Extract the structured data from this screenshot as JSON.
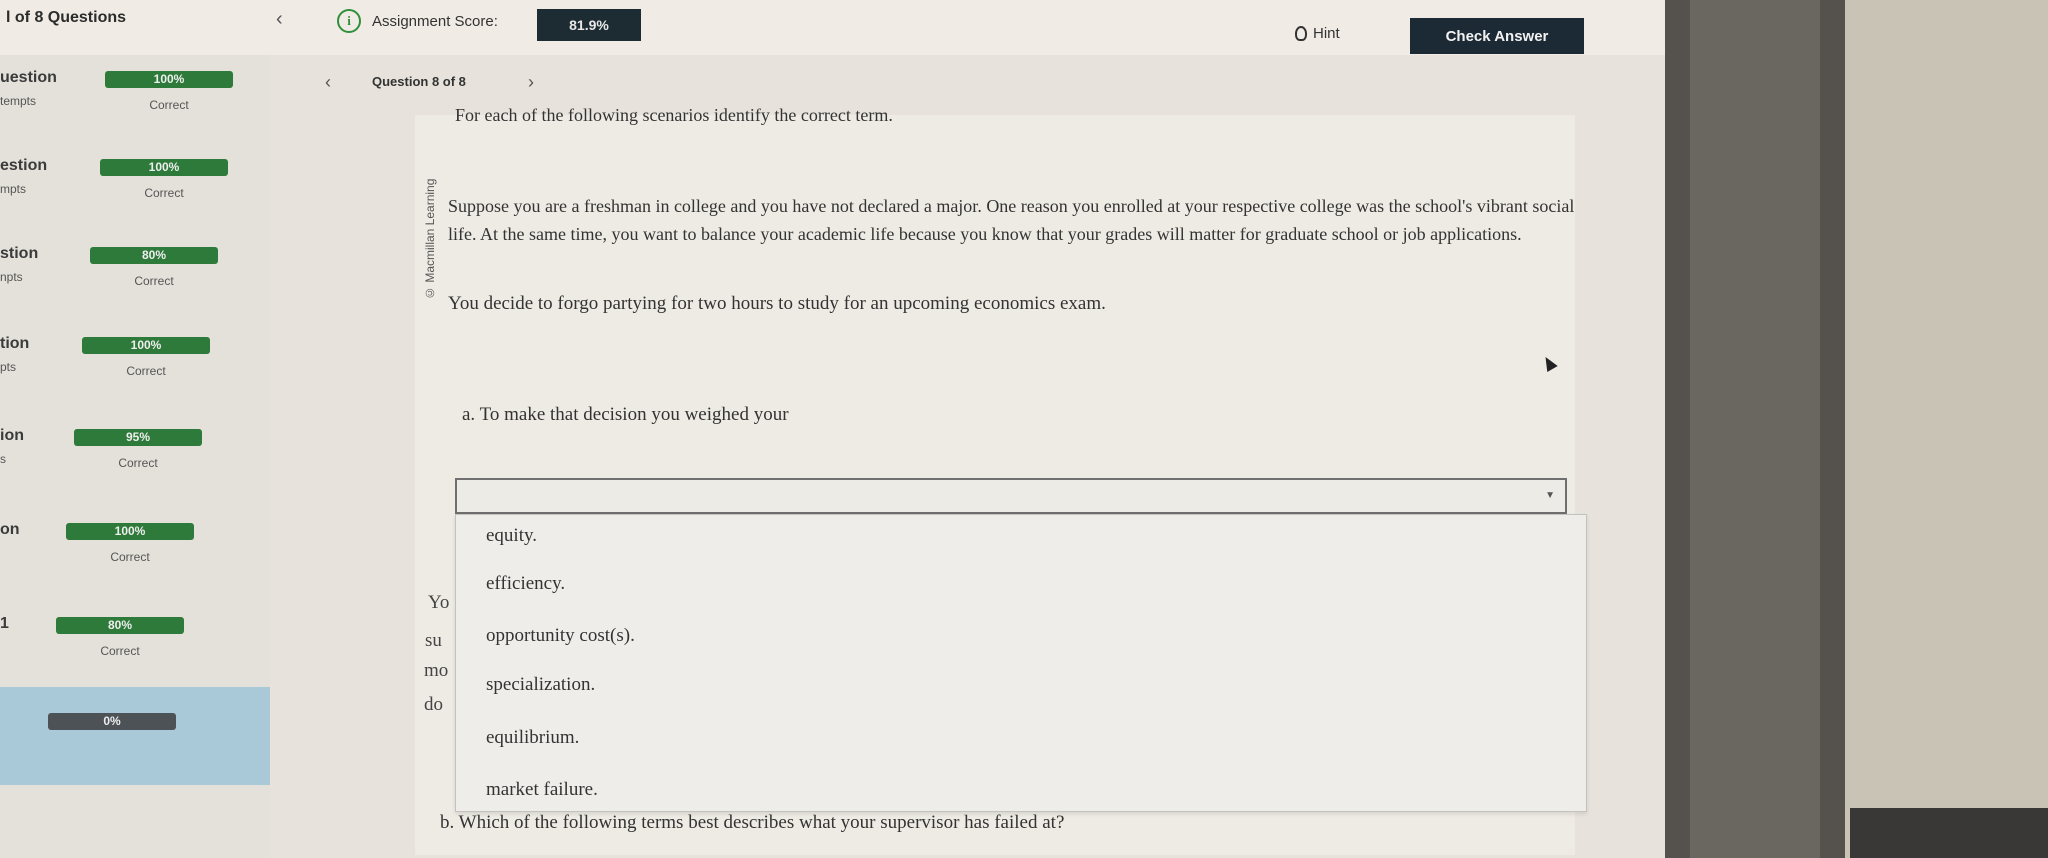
{
  "header": {
    "question_count": "l of 8 Questions",
    "score_label": "Assignment Score:",
    "score_value": "81.9%",
    "hint_label": "Hint",
    "check_answer_label": "Check Answer"
  },
  "sidebar": {
    "items": [
      {
        "label": "uestion",
        "attempts": "tempts",
        "percent": "100%",
        "status": "Correct"
      },
      {
        "label": "estion",
        "attempts": "mpts",
        "percent": "100%",
        "status": "Correct"
      },
      {
        "label": "stion",
        "attempts": "npts",
        "percent": "80%",
        "status": "Correct"
      },
      {
        "label": "tion",
        "attempts": "pts",
        "percent": "100%",
        "status": "Correct"
      },
      {
        "label": "ion",
        "attempts": "s",
        "percent": "95%",
        "status": "Correct"
      },
      {
        "label": "on",
        "attempts": "",
        "percent": "100%",
        "status": "Correct"
      },
      {
        "label": "1",
        "attempts": "",
        "percent": "80%",
        "status": "Correct"
      },
      {
        "label": "",
        "attempts": "",
        "percent": "0%",
        "status": ""
      }
    ]
  },
  "question": {
    "label": "Question 8 of 8",
    "instructions": "For each of the following scenarios identify the correct term.",
    "credit": "© Macmillan Learning",
    "scenario": "Suppose you are a freshman in college and you have not declared a major. One reason you enrolled at your respective college was the school's vibrant social life. At the same time, you want to balance your academic life because you know that your grades will matter for graduate school or job applications.",
    "decision": "You decide to forgo partying for two hours to study for an upcoming economics exam.",
    "part_a": "a. To make that decision you weighed your",
    "part_b": "b. Which of the following terms best describes what your supervisor has failed at?",
    "background_fragments": [
      "Yo",
      "su",
      "mo",
      "do"
    ]
  },
  "dropdown": {
    "selected": "",
    "options": [
      "equity.",
      "efficiency.",
      "opportunity cost(s).",
      "specialization.",
      "equilibrium.",
      "market failure."
    ]
  }
}
